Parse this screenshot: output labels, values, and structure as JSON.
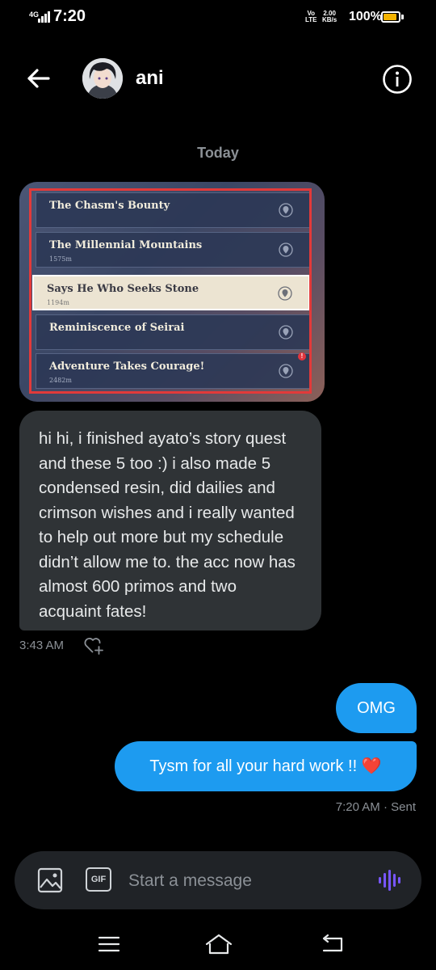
{
  "status_bar": {
    "network": "4G",
    "time": "7:20",
    "lte_top": "Vo",
    "lte_bottom": "LTE",
    "speed_value": "2.00",
    "speed_unit": "KB/s",
    "battery_percent": "100%",
    "battery_level": 0.9,
    "battery_color": "#f3b300"
  },
  "header": {
    "contact_name": "ani"
  },
  "conversation": {
    "date_label": "Today",
    "image_message": {
      "quests": [
        {
          "title": "The Chasm's Bounty",
          "distance": ""
        },
        {
          "title": "The Millennial Mountains",
          "distance": "1575m"
        },
        {
          "title": "Says He Who Seeks Stone",
          "distance": "1194m"
        },
        {
          "title": "Reminiscence of Seirai",
          "distance": ""
        },
        {
          "title": "Adventure Takes Courage!",
          "distance": "2482m"
        }
      ],
      "alert_mark": "!"
    },
    "received_text": "hi hi, i finished ayato’s story quest and these 5 too :) i also made 5 condensed resin, did dailies and crimson wishes and i really wanted to help out more but my schedule didn’t allow me to. the acc now has almost 600 primos and two acquaint fates!",
    "received_time": "3:43 AM",
    "sent_1": "OMG",
    "sent_2": "Tysm for all your hard work !! ❤️",
    "sent_status": "7:20 AM · Sent"
  },
  "composer": {
    "gif_label": "GIF",
    "placeholder": "Start a message"
  },
  "colors": {
    "background": "#000000",
    "bubble_received": "#2f3336",
    "bubble_sent": "#1d9bf0",
    "voice_icon": "#7856ff",
    "highlight_frame": "#e23a3a"
  }
}
